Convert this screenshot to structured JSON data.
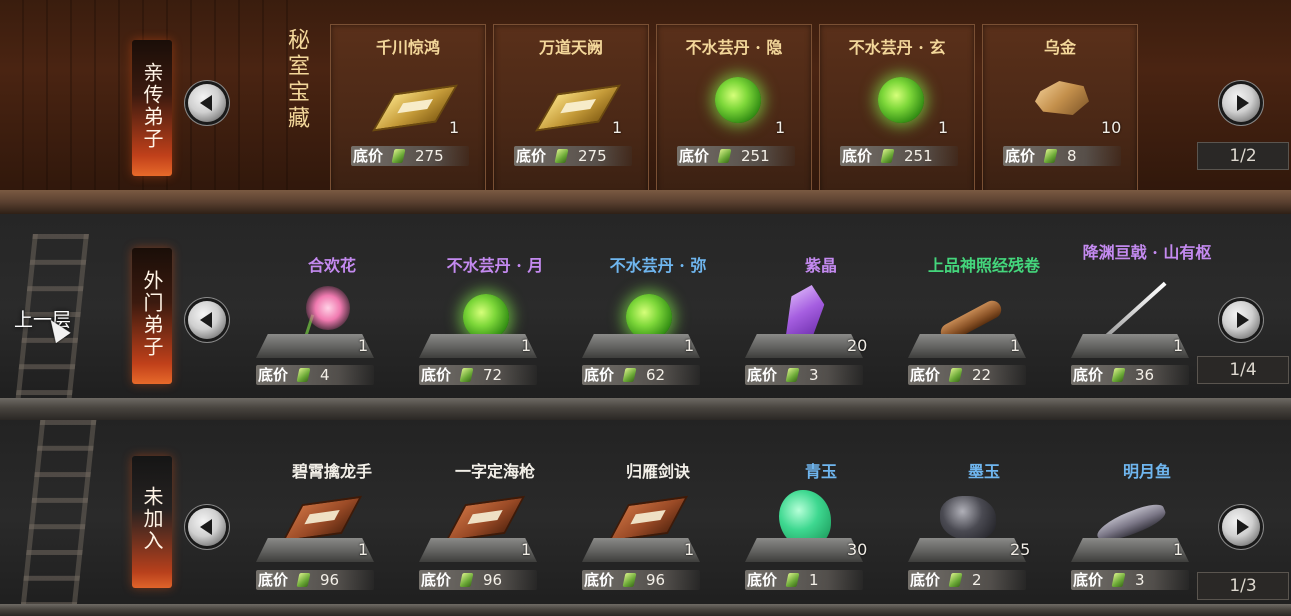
{
  "floor_nav": {
    "label": "上一层"
  },
  "shelves": [
    {
      "tier_label": "亲传弟子",
      "title": "秘室宝藏",
      "page": "1/2",
      "price_label": "底价",
      "items": [
        {
          "name": "千川惊鸿",
          "qty": "1",
          "price": "275",
          "icon": "book-scroll-icon",
          "color": "#f3d79a"
        },
        {
          "name": "万道天阙",
          "qty": "1",
          "price": "275",
          "icon": "book-scroll-icon",
          "color": "#f3d79a"
        },
        {
          "name": "不水芸丹 · 隐",
          "qty": "1",
          "price": "251",
          "icon": "pill-icon",
          "color": "#f3d79a"
        },
        {
          "name": "不水芸丹 · 玄",
          "qty": "1",
          "price": "251",
          "icon": "pill-icon",
          "color": "#f3d79a"
        },
        {
          "name": "乌金",
          "qty": "10",
          "price": "8",
          "icon": "ore-icon",
          "color": "#f3d79a"
        }
      ]
    },
    {
      "tier_label": "外门弟子",
      "page": "1/4",
      "price_label": "底价",
      "items": [
        {
          "name": "合欢花",
          "qty": "1",
          "price": "4",
          "icon": "flower-icon",
          "color": "#c48af0"
        },
        {
          "name": "不水芸丹 · 月",
          "qty": "1",
          "price": "72",
          "icon": "pill-icon",
          "color": "#c48af0"
        },
        {
          "name": "不水芸丹 · 弥",
          "qty": "1",
          "price": "62",
          "icon": "pill-icon",
          "color": "#6fb6ef"
        },
        {
          "name": "紫晶",
          "qty": "20",
          "price": "3",
          "icon": "crystal-icon",
          "color": "#c48af0"
        },
        {
          "name": "上品神照经残卷",
          "qty": "1",
          "price": "22",
          "icon": "rolled-scroll-icon",
          "color": "#44d67c"
        },
        {
          "name": "降渊亘戟 · 山有枢",
          "qty": "1",
          "price": "36",
          "icon": "spear-icon",
          "color": "#c48af0"
        }
      ]
    },
    {
      "tier_label": "未加入",
      "page": "1/3",
      "price_label": "底价",
      "items": [
        {
          "name": "碧霄擒龙手",
          "qty": "1",
          "price": "96",
          "icon": "book-brown-icon",
          "color": "#f2efe8"
        },
        {
          "name": "一字定海枪",
          "qty": "1",
          "price": "96",
          "icon": "book-brown-icon",
          "color": "#f2efe8"
        },
        {
          "name": "归雁剑诀",
          "qty": "1",
          "price": "96",
          "icon": "book-brown-icon",
          "color": "#f2efe8"
        },
        {
          "name": "青玉",
          "qty": "30",
          "price": "1",
          "icon": "jade-icon",
          "color": "#6fb6ef"
        },
        {
          "name": "墨玉",
          "qty": "25",
          "price": "2",
          "icon": "ink-jade-icon",
          "color": "#6fb6ef"
        },
        {
          "name": "明月鱼",
          "qty": "1",
          "price": "3",
          "icon": "fish-icon",
          "color": "#6fb6ef"
        }
      ]
    }
  ]
}
